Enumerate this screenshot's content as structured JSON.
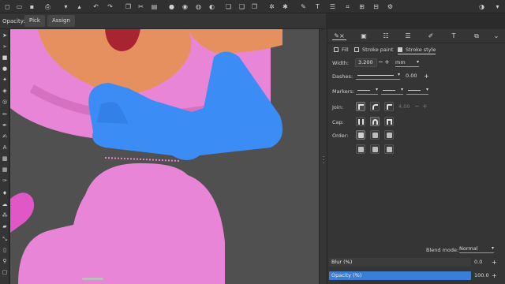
{
  "commandbar": {
    "icons": [
      "new-document-icon",
      "open-icon",
      "save-icon",
      "print-icon",
      "import-icon",
      "export-icon",
      "undo-icon",
      "redo-icon",
      "copy-icon",
      "cut-icon",
      "paste-icon",
      "zoom-selection-icon",
      "zoom-drawing-icon",
      "zoom-page-icon",
      "zoom-page-width-icon",
      "duplicate-icon",
      "clone-icon",
      "unlink-clone-icon",
      "group-icon",
      "ungroup-icon",
      "fill-stroke-icon",
      "text-icon",
      "layers-icon",
      "xml-editor-icon",
      "align-icon",
      "document-properties-icon",
      "preferences-icon",
      "more-icon"
    ]
  },
  "tool_controls": {
    "opacity_label": "Opacity:",
    "pick_label": "Pick",
    "assign_label": "Assign"
  },
  "toolbox": {
    "tools": [
      "selector-icon",
      "node-icon",
      "rectangle-icon",
      "ellipse-icon",
      "star-icon",
      "3d-box-icon",
      "spiral-icon",
      "pencil-icon",
      "pen-icon",
      "calligraphy-icon",
      "text-icon",
      "gradient-icon",
      "mesh-icon",
      "dropper-icon",
      "paint-bucket-icon",
      "tweak-icon",
      "spray-icon",
      "eraser-icon",
      "connector-icon",
      "measure-icon",
      "zoom-icon",
      "pages-icon"
    ]
  },
  "dock": {
    "tabs": [
      "fill-stroke-tab-icon",
      "document-properties-tab-icon",
      "objects-tab-icon",
      "layers-tab-icon",
      "xml-editor-tab-icon",
      "text-font-tab-icon",
      "export-tab-icon",
      "more-tab-icon"
    ],
    "subtabs": {
      "fill": "Fill",
      "stroke_paint": "Stroke paint",
      "stroke_style": "Stroke style"
    },
    "width_label": "Width:",
    "width_value": "3.200",
    "width_unit": "mm",
    "dashes_label": "Dashes:",
    "dash_offset": "0.00",
    "markers_label": "Markers:",
    "join_label": "Join:",
    "miter_value": "4.00",
    "cap_label": "Cap:",
    "order_label": "Order:",
    "blend_label": "Blend mode:",
    "blend_value": "Normal",
    "blur_label": "Blur (%)",
    "blur_value": "0.0",
    "opacity_label": "Opacity (%)",
    "opacity_value": "100.0"
  },
  "colors": {
    "canvas_bg": "#505050",
    "pink": "#e985d6",
    "orange": "#e7905f",
    "blue": "#3b8cf5",
    "accent": "#3a7fd5"
  }
}
